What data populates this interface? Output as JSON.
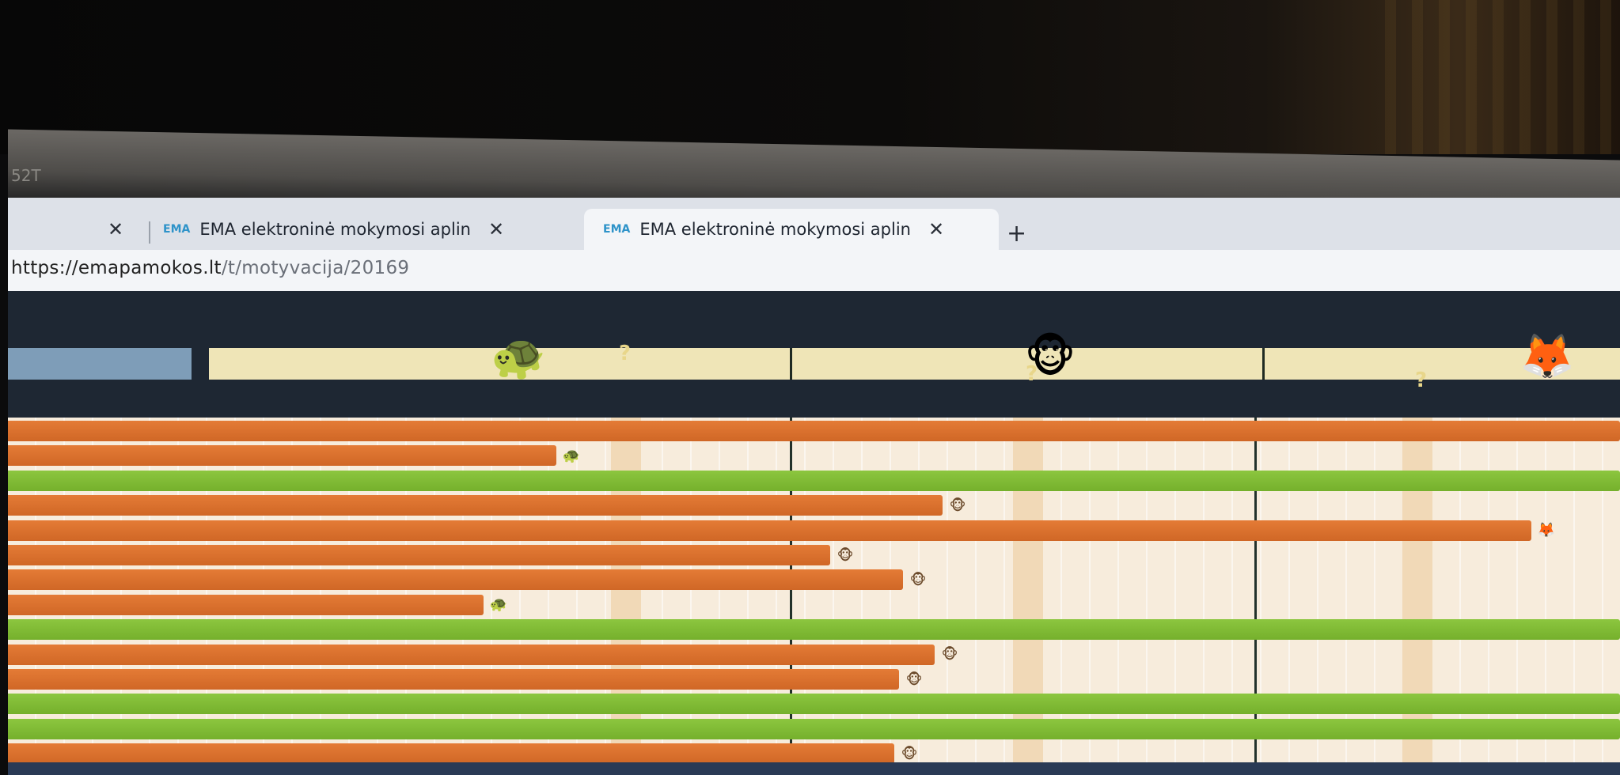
{
  "monitor": {
    "model_label": "52T"
  },
  "browser": {
    "tabs": [
      {
        "favicon": "EMA",
        "title": "EMA elektroninė mokymosi aplin",
        "close": "✕",
        "active": false
      },
      {
        "favicon": "EMA",
        "title": "EMA elektroninė mokymosi aplin",
        "close": "✕",
        "active": true
      }
    ],
    "first_tab_close": "✕",
    "new_tab": "+",
    "url_host": "https://emapamokos.lt",
    "url_path": "/t/motyvacija/20169"
  },
  "motivation": {
    "milestones": [
      {
        "animal": "turtle-icon",
        "glyph": "🐢",
        "question": "?"
      },
      {
        "animal": "monkey-icon",
        "glyph": "🐵",
        "question": "?"
      },
      {
        "animal": "fox-icon",
        "glyph": "🦊",
        "question": "?"
      }
    ],
    "rows": [
      {
        "color": "orange",
        "progress": 1.0,
        "icon": ""
      },
      {
        "color": "orange",
        "progress": 0.34,
        "icon": "🐢"
      },
      {
        "color": "green",
        "progress": 1.0,
        "icon": ""
      },
      {
        "color": "orange",
        "progress": 0.58,
        "icon": "🐵"
      },
      {
        "color": "orange",
        "progress": 0.945,
        "icon": "🦊"
      },
      {
        "color": "orange",
        "progress": 0.51,
        "icon": "🐵"
      },
      {
        "color": "orange",
        "progress": 0.555,
        "icon": "🐵"
      },
      {
        "color": "orange",
        "progress": 0.295,
        "icon": "🐢"
      },
      {
        "color": "green",
        "progress": 1.0,
        "icon": ""
      },
      {
        "color": "orange",
        "progress": 0.575,
        "icon": "🐵"
      },
      {
        "color": "orange",
        "progress": 0.553,
        "icon": "🐵"
      },
      {
        "color": "green",
        "progress": 1.0,
        "icon": ""
      },
      {
        "color": "green",
        "progress": 1.0,
        "icon": ""
      },
      {
        "color": "orange",
        "progress": 0.55,
        "icon": "🐵"
      }
    ],
    "colors": {
      "orange": "#e47b36",
      "green": "#8cc63f",
      "track": "#efe5b7",
      "blue": "#7e9db8"
    }
  }
}
